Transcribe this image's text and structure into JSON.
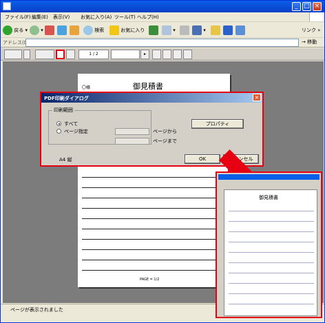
{
  "menus": [
    "ファイル(F)",
    "編集(E)",
    "表示(V)",
    "お気に入り(A)",
    "ツール(T)",
    "ヘルプ(H)"
  ],
  "nav": {
    "back": "戻る",
    "search": "検索",
    "favorites": "お気に入り",
    "links": "リンク"
  },
  "address": {
    "label": "アドレス(D)",
    "go": "移動"
  },
  "pdf_toolbar": {
    "page_indicator": "1 / 2"
  },
  "document": {
    "title": "御見積書",
    "client": "〇様",
    "page_footer": "PAGE = 1/2"
  },
  "dialog": {
    "title": "PDF印刷ダイアログ",
    "group_label": "印刷範囲",
    "opt_all": "すべて",
    "opt_range": "ページ指定",
    "from_label": "ページから",
    "to_label": "ページまで",
    "properties": "プロパティ",
    "paper": "A4 縦",
    "ok": "OK",
    "cancel": "キャンセル"
  },
  "thumbnail": {
    "title": "御見積書"
  },
  "status": {
    "text": "ページが表示されました"
  }
}
